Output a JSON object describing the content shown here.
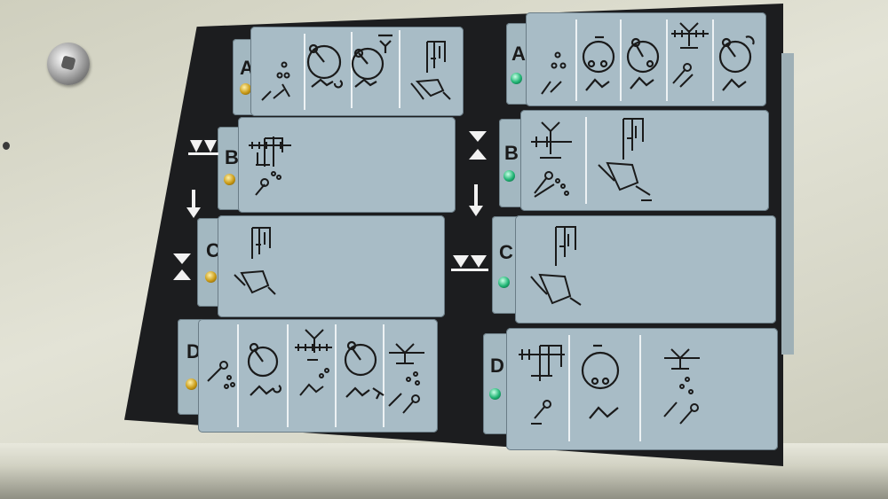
{
  "left_column": {
    "rows": [
      {
        "letter": "A",
        "led": "amber"
      },
      {
        "letter": "B",
        "led": "amber"
      },
      {
        "letter": "C",
        "led": "amber"
      },
      {
        "letter": "D",
        "led": "amber"
      }
    ]
  },
  "right_column": {
    "rows": [
      {
        "letter": "A",
        "led": "green"
      },
      {
        "letter": "B",
        "led": "green"
      },
      {
        "letter": "C",
        "led": "green"
      },
      {
        "letter": "D",
        "led": "green"
      }
    ]
  },
  "colors": {
    "panel": "#1c1d1f",
    "slot": "#a8bcc6",
    "led_amber": "#c99a16",
    "led_green": "#1fb473",
    "casing": "#d9d8c9"
  },
  "icons": [
    "presser-foot-icon",
    "thread-spool-icon",
    "needle-bar-icon",
    "knee-lever-icon",
    "arrow-down-icon",
    "join-arrows-icon",
    "split-arrows-icon"
  ]
}
